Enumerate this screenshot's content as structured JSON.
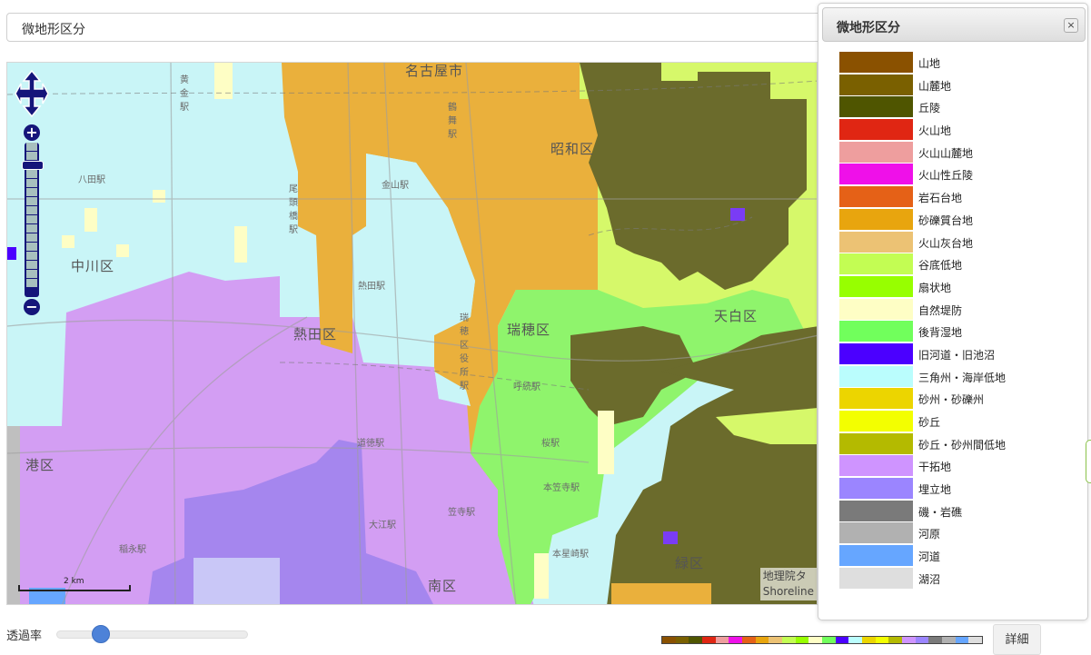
{
  "header": {
    "title": "微地形区分"
  },
  "map": {
    "places": [
      "名古屋市",
      "昭和区",
      "中川区",
      "熱田区",
      "瑞穂区",
      "天白区",
      "港区",
      "南区",
      "緑区"
    ],
    "stations": [
      "黄金駅",
      "八田駅",
      "金山駅",
      "熱田駅",
      "尾頭橋駅",
      "瑞穂区役所駅",
      "呼続駅",
      "桜駅",
      "本笠寺駅",
      "笠寺駅",
      "大江駅",
      "稲永駅",
      "道徳駅",
      "本星崎駅",
      "鶴舞駅"
    ],
    "scale_label": "2 km",
    "attribution": [
      "地理院タ",
      "Shoreline"
    ]
  },
  "legend": {
    "title": "微地形区分",
    "close_label": "×",
    "items": [
      {
        "label": "山地",
        "color": "#8a5100"
      },
      {
        "label": "山麓地",
        "color": "#7a6000"
      },
      {
        "label": "丘陵",
        "color": "#4f5500"
      },
      {
        "label": "火山地",
        "color": "#e02613"
      },
      {
        "label": "火山山麓地",
        "color": "#ee9e9e"
      },
      {
        "label": "火山性丘陵",
        "color": "#ef10e9"
      },
      {
        "label": "岩石台地",
        "color": "#e56117"
      },
      {
        "label": "砂礫質台地",
        "color": "#e8a50e"
      },
      {
        "label": "火山灰台地",
        "color": "#ecc274"
      },
      {
        "label": "谷底低地",
        "color": "#c3fd53"
      },
      {
        "label": "扇状地",
        "color": "#97ff00"
      },
      {
        "label": "自然堤防",
        "color": "#fefec5"
      },
      {
        "label": "後背湿地",
        "color": "#71ff5c"
      },
      {
        "label": "旧河道・旧池沼",
        "color": "#4b00ff"
      },
      {
        "label": "三角州・海岸低地",
        "color": "#bafdfd"
      },
      {
        "label": "砂州・砂礫州",
        "color": "#ecd500"
      },
      {
        "label": "砂丘",
        "color": "#f3ff00"
      },
      {
        "label": "砂丘・砂州間低地",
        "color": "#b4ba00"
      },
      {
        "label": "干拓地",
        "color": "#cf94ff"
      },
      {
        "label": "埋立地",
        "color": "#9b85ff"
      },
      {
        "label": "磯・岩礁",
        "color": "#7a7a7a"
      },
      {
        "label": "河原",
        "color": "#b1b1b1"
      },
      {
        "label": "河道",
        "color": "#66a6ff"
      },
      {
        "label": "湖沼",
        "color": "#dedede"
      }
    ]
  },
  "controls": {
    "opacity_label": "透過率",
    "opacity_value": 0.2,
    "detail_label": "詳細"
  }
}
